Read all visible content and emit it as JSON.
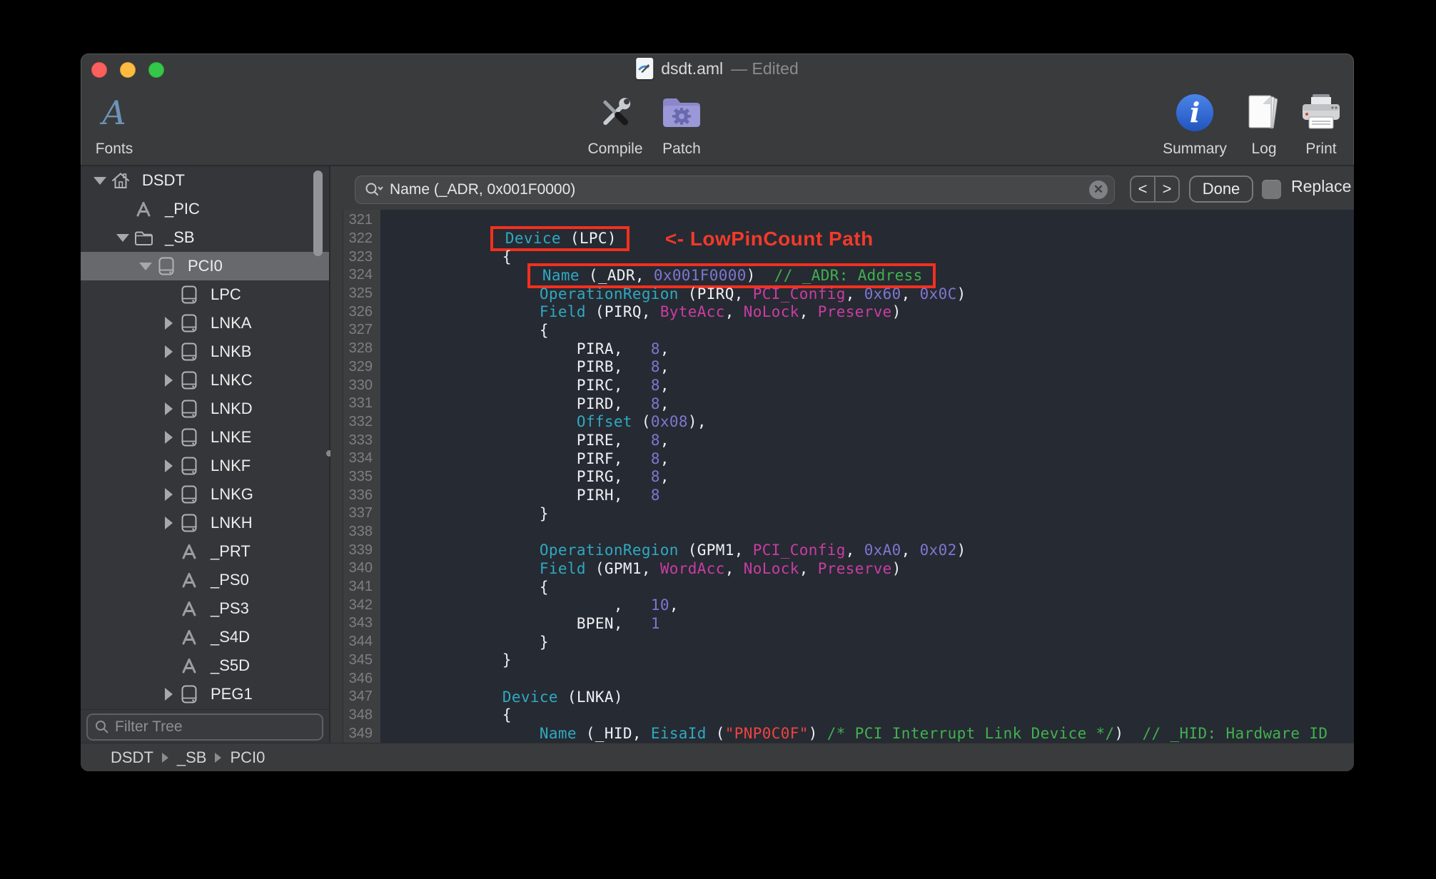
{
  "window": {
    "title_file": "dsdt.aml",
    "title_suffix": "— Edited"
  },
  "toolbar": {
    "fonts": "Fonts",
    "compile": "Compile",
    "patch": "Patch",
    "summary": "Summary",
    "log": "Log",
    "print": "Print"
  },
  "findbar": {
    "query": "Name (_ADR, 0x001F0000)",
    "prev": "<",
    "next": ">",
    "done": "Done",
    "replace": "Replace"
  },
  "sidebar": {
    "filter_placeholder": "Filter Tree",
    "items": [
      {
        "label": "DSDT",
        "icon": "home",
        "indent": 0,
        "disclosure": "open",
        "selected": false
      },
      {
        "label": "_PIC",
        "icon": "method",
        "indent": 1,
        "disclosure": "none",
        "selected": false
      },
      {
        "label": "_SB",
        "icon": "folder",
        "indent": 1,
        "disclosure": "open",
        "selected": false
      },
      {
        "label": "PCI0",
        "icon": "device",
        "indent": 2,
        "disclosure": "open",
        "selected": true
      },
      {
        "label": "LPC",
        "icon": "device",
        "indent": 3,
        "disclosure": "none",
        "selected": false
      },
      {
        "label": "LNKA",
        "icon": "device",
        "indent": 3,
        "disclosure": "closed",
        "selected": false
      },
      {
        "label": "LNKB",
        "icon": "device",
        "indent": 3,
        "disclosure": "closed",
        "selected": false
      },
      {
        "label": "LNKC",
        "icon": "device",
        "indent": 3,
        "disclosure": "closed",
        "selected": false
      },
      {
        "label": "LNKD",
        "icon": "device",
        "indent": 3,
        "disclosure": "closed",
        "selected": false
      },
      {
        "label": "LNKE",
        "icon": "device",
        "indent": 3,
        "disclosure": "closed",
        "selected": false
      },
      {
        "label": "LNKF",
        "icon": "device",
        "indent": 3,
        "disclosure": "closed",
        "selected": false
      },
      {
        "label": "LNKG",
        "icon": "device",
        "indent": 3,
        "disclosure": "closed",
        "selected": false
      },
      {
        "label": "LNKH",
        "icon": "device",
        "indent": 3,
        "disclosure": "closed",
        "selected": false
      },
      {
        "label": "_PRT",
        "icon": "method",
        "indent": 3,
        "disclosure": "none",
        "selected": false
      },
      {
        "label": "_PS0",
        "icon": "method",
        "indent": 3,
        "disclosure": "none",
        "selected": false
      },
      {
        "label": "_PS3",
        "icon": "method",
        "indent": 3,
        "disclosure": "none",
        "selected": false
      },
      {
        "label": "_S4D",
        "icon": "method",
        "indent": 3,
        "disclosure": "none",
        "selected": false
      },
      {
        "label": "_S5D",
        "icon": "method",
        "indent": 3,
        "disclosure": "none",
        "selected": false
      },
      {
        "label": "PEG1",
        "icon": "device",
        "indent": 3,
        "disclosure": "closed",
        "selected": false
      }
    ]
  },
  "statusbar": {
    "breadcrumb": [
      "DSDT",
      "_SB",
      "PCI0"
    ]
  },
  "editor": {
    "annotation_text": "<- LowPinCount Path",
    "lines": [
      {
        "no": 321,
        "indent": 0,
        "segs": []
      },
      {
        "no": 322,
        "indent": 12,
        "box": true,
        "anno": true,
        "segs": [
          [
            "kw",
            "Device"
          ],
          [
            "pl",
            " (LPC)"
          ]
        ]
      },
      {
        "no": 323,
        "indent": 12,
        "segs": [
          [
            "pl",
            "{"
          ]
        ]
      },
      {
        "no": 324,
        "indent": 16,
        "box": true,
        "segs": [
          [
            "kw",
            "Name"
          ],
          [
            "pl",
            " (_ADR, "
          ],
          [
            "num",
            "0x001F0000"
          ],
          [
            "pl",
            ")  "
          ],
          [
            "com",
            "// _ADR: Address"
          ]
        ]
      },
      {
        "no": 325,
        "indent": 16,
        "segs": [
          [
            "kw",
            "OperationRegion"
          ],
          [
            "pl",
            " (PIRQ, "
          ],
          [
            "type",
            "PCI_Config"
          ],
          [
            "pl",
            ", "
          ],
          [
            "num",
            "0x60"
          ],
          [
            "pl",
            ", "
          ],
          [
            "num",
            "0x0C"
          ],
          [
            "pl",
            ")"
          ]
        ]
      },
      {
        "no": 326,
        "indent": 16,
        "segs": [
          [
            "kw",
            "Field"
          ],
          [
            "pl",
            " (PIRQ, "
          ],
          [
            "type",
            "ByteAcc"
          ],
          [
            "pl",
            ", "
          ],
          [
            "type",
            "NoLock"
          ],
          [
            "pl",
            ", "
          ],
          [
            "type",
            "Preserve"
          ],
          [
            "pl",
            ")"
          ]
        ]
      },
      {
        "no": 327,
        "indent": 16,
        "segs": [
          [
            "pl",
            "{"
          ]
        ]
      },
      {
        "no": 328,
        "indent": 20,
        "segs": [
          [
            "pl",
            "PIRA,   "
          ],
          [
            "num",
            "8"
          ],
          [
            "pl",
            ","
          ]
        ]
      },
      {
        "no": 329,
        "indent": 20,
        "segs": [
          [
            "pl",
            "PIRB,   "
          ],
          [
            "num",
            "8"
          ],
          [
            "pl",
            ","
          ]
        ]
      },
      {
        "no": 330,
        "indent": 20,
        "segs": [
          [
            "pl",
            "PIRC,   "
          ],
          [
            "num",
            "8"
          ],
          [
            "pl",
            ","
          ]
        ]
      },
      {
        "no": 331,
        "indent": 20,
        "segs": [
          [
            "pl",
            "PIRD,   "
          ],
          [
            "num",
            "8"
          ],
          [
            "pl",
            ","
          ]
        ]
      },
      {
        "no": 332,
        "indent": 20,
        "segs": [
          [
            "kw",
            "Offset"
          ],
          [
            "pl",
            " ("
          ],
          [
            "num",
            "0x08"
          ],
          [
            "pl",
            "),"
          ]
        ]
      },
      {
        "no": 333,
        "indent": 20,
        "segs": [
          [
            "pl",
            "PIRE,   "
          ],
          [
            "num",
            "8"
          ],
          [
            "pl",
            ","
          ]
        ]
      },
      {
        "no": 334,
        "indent": 20,
        "segs": [
          [
            "pl",
            "PIRF,   "
          ],
          [
            "num",
            "8"
          ],
          [
            "pl",
            ","
          ]
        ]
      },
      {
        "no": 335,
        "indent": 20,
        "segs": [
          [
            "pl",
            "PIRG,   "
          ],
          [
            "num",
            "8"
          ],
          [
            "pl",
            ","
          ]
        ]
      },
      {
        "no": 336,
        "indent": 20,
        "segs": [
          [
            "pl",
            "PIRH,   "
          ],
          [
            "num",
            "8"
          ]
        ]
      },
      {
        "no": 337,
        "indent": 16,
        "segs": [
          [
            "pl",
            "}"
          ]
        ]
      },
      {
        "no": 338,
        "indent": 0,
        "segs": []
      },
      {
        "no": 339,
        "indent": 16,
        "segs": [
          [
            "kw",
            "OperationRegion"
          ],
          [
            "pl",
            " (GPM1, "
          ],
          [
            "type",
            "PCI_Config"
          ],
          [
            "pl",
            ", "
          ],
          [
            "num",
            "0xA0"
          ],
          [
            "pl",
            ", "
          ],
          [
            "num",
            "0x02"
          ],
          [
            "pl",
            ")"
          ]
        ]
      },
      {
        "no": 340,
        "indent": 16,
        "segs": [
          [
            "kw",
            "Field"
          ],
          [
            "pl",
            " (GPM1, "
          ],
          [
            "type",
            "WordAcc"
          ],
          [
            "pl",
            ", "
          ],
          [
            "type",
            "NoLock"
          ],
          [
            "pl",
            ", "
          ],
          [
            "type",
            "Preserve"
          ],
          [
            "pl",
            ")"
          ]
        ]
      },
      {
        "no": 341,
        "indent": 16,
        "segs": [
          [
            "pl",
            "{"
          ]
        ]
      },
      {
        "no": 342,
        "indent": 24,
        "segs": [
          [
            "pl",
            ",   "
          ],
          [
            "num",
            "10"
          ],
          [
            "pl",
            ","
          ]
        ]
      },
      {
        "no": 343,
        "indent": 20,
        "segs": [
          [
            "pl",
            "BPEN,   "
          ],
          [
            "num",
            "1"
          ]
        ]
      },
      {
        "no": 344,
        "indent": 16,
        "segs": [
          [
            "pl",
            "}"
          ]
        ]
      },
      {
        "no": 345,
        "indent": 12,
        "segs": [
          [
            "pl",
            "}"
          ]
        ]
      },
      {
        "no": 346,
        "indent": 0,
        "segs": []
      },
      {
        "no": 347,
        "indent": 12,
        "segs": [
          [
            "kw",
            "Device"
          ],
          [
            "pl",
            " (LNKA)"
          ]
        ]
      },
      {
        "no": 348,
        "indent": 12,
        "segs": [
          [
            "pl",
            "{"
          ]
        ]
      },
      {
        "no": 349,
        "indent": 16,
        "segs": [
          [
            "kw",
            "Name"
          ],
          [
            "pl",
            " (_HID, "
          ],
          [
            "kw",
            "EisaId"
          ],
          [
            "pl",
            " ("
          ],
          [
            "str",
            "\"PNP0C0F\""
          ],
          [
            "pl",
            ") "
          ],
          [
            "com",
            "/* PCI Interrupt Link Device */"
          ],
          [
            "pl",
            ")  "
          ],
          [
            "com",
            "// _HID: Hardware ID"
          ]
        ]
      }
    ]
  },
  "colors": {
    "annotation_red": "#f2301e",
    "keyword_teal": "#2fa9c0",
    "argtype_magenta": "#c93da2",
    "number_purple": "#7f76d0",
    "comment_green": "#41b14e",
    "string_red": "#ee4440",
    "editor_bg": "#262a33",
    "chrome_bg": "#3a3b3c",
    "sidebar_bg": "#343639",
    "traffic_red": "#fc605c",
    "traffic_yellow": "#fdbc40",
    "traffic_green": "#34c748"
  }
}
